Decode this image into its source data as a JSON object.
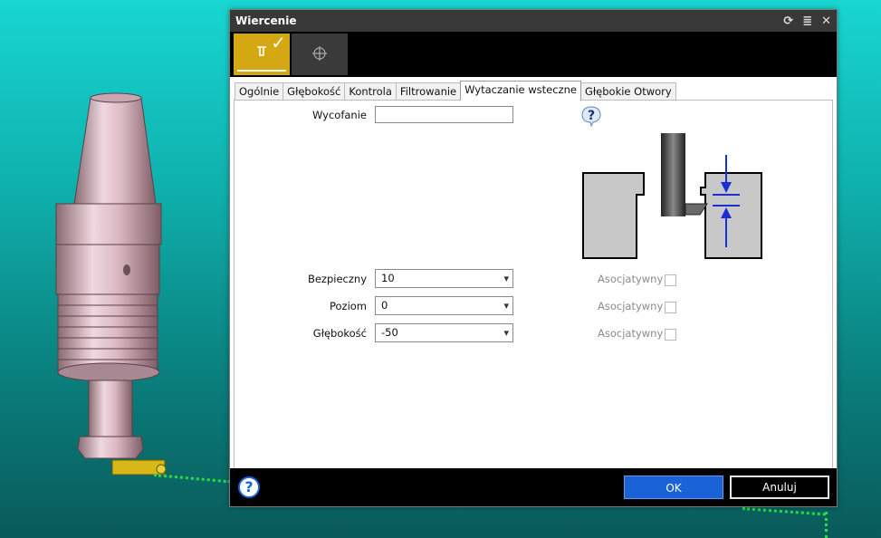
{
  "dialog": {
    "title": "Wiercenie",
    "title_icons": [
      "refresh-icon",
      "menu-icon",
      "close-icon"
    ],
    "modes": [
      {
        "icon": "drill-cycle-icon",
        "active": true
      },
      {
        "icon": "crosshair-icon",
        "active": false
      }
    ],
    "tabs": [
      {
        "label": "Ogólnie",
        "active": false
      },
      {
        "label": "Głębokość",
        "active": false
      },
      {
        "label": "Kontrola",
        "active": false
      },
      {
        "label": "Filtrowanie",
        "active": false
      },
      {
        "label": "Wytaczanie wsteczne",
        "active": true
      },
      {
        "label": "Głębokie Otwory",
        "active": false
      }
    ],
    "fields": {
      "retract": {
        "label": "Wycofanie",
        "value": ""
      },
      "safe": {
        "label": "Bezpieczny",
        "value": "10",
        "assoc_label": "Asocjatywny",
        "assoc_checked": false
      },
      "level": {
        "label": "Poziom",
        "value": "0",
        "assoc_label": "Asocjatywny",
        "assoc_checked": false
      },
      "depth": {
        "label": "Głębokość",
        "value": "-50",
        "assoc_label": "Asocjatywny",
        "assoc_checked": false
      }
    },
    "footer": {
      "ok_label": "OK",
      "cancel_label": "Anuluj",
      "help_symbol": "?"
    }
  },
  "colors": {
    "accent": "#1a63d6",
    "mode_active": "#d4a812",
    "toolpath": "#28e040"
  }
}
